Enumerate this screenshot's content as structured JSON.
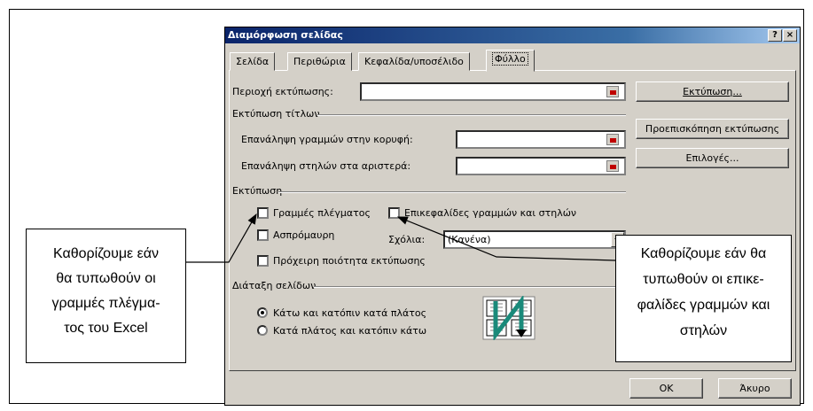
{
  "dialog": {
    "title": "Διαμόρφωση σελίδας",
    "help_label": "?",
    "close_label": "×",
    "tabs": [
      {
        "label": "Σελίδα"
      },
      {
        "label": "Περιθώρια"
      },
      {
        "label": "Κεφαλίδα/υποσέλιδο"
      },
      {
        "label": "Φύλλο"
      }
    ],
    "active_tab": "Φύλλο"
  },
  "sheet": {
    "print_area_label": "Περιοχή εκτύπωσης:",
    "print_area_value": "",
    "print_titles_header": "Εκτύπωση τίτλων",
    "rows_repeat_label": "Επανάληψη γραμμών στην κορυφή:",
    "rows_repeat_value": "",
    "cols_repeat_label": "Επανάληψη στηλών στα αριστερά:",
    "cols_repeat_value": "",
    "print_header": "Εκτύπωση",
    "gridlines_label": "Γραμμές πλέγματος",
    "gridlines_checked": false,
    "headings_label": "Επικεφαλίδες γραμμών και στηλών",
    "headings_checked": false,
    "bw_label": "Ασπρόμαυρη",
    "bw_checked": false,
    "comments_label": "Σχόλια:",
    "comments_value": "(Κανένα)",
    "draft_label": "Πρόχειρη ποιότητα εκτύπωσης",
    "draft_checked": false,
    "page_order_header": "Διάταξη σελίδων",
    "order_down_label": "Κάτω και κατόπιν κατά πλάτος",
    "order_over_label": "Κατά πλάτος και κατόπιν κάτω",
    "order_selected": "down_then_over"
  },
  "buttons": {
    "print": "Εκτύπωση...",
    "preview": "Προεπισκόπηση εκτύπωσης",
    "options": "Επιλογές...",
    "ok": "OK",
    "cancel": "Άκυρο"
  },
  "callouts": {
    "left": [
      "Καθορίζουμε εάν",
      "θα τυπωθούν οι",
      "γραμμές πλέγμα-",
      "τος του Excel"
    ],
    "right": [
      "Καθορίζουμε εάν θα",
      "τυπωθούν οι επικε-",
      "φαλίδες γραμμών και",
      "στηλών"
    ]
  },
  "colors": {
    "titlebar_start": "#0a246a",
    "dialog_face": "#d4d0c8",
    "order_graphic": "#1a8a7a"
  },
  "icons": {
    "range_picker": "range-picker-icon",
    "page_order": "page-order-icon"
  }
}
